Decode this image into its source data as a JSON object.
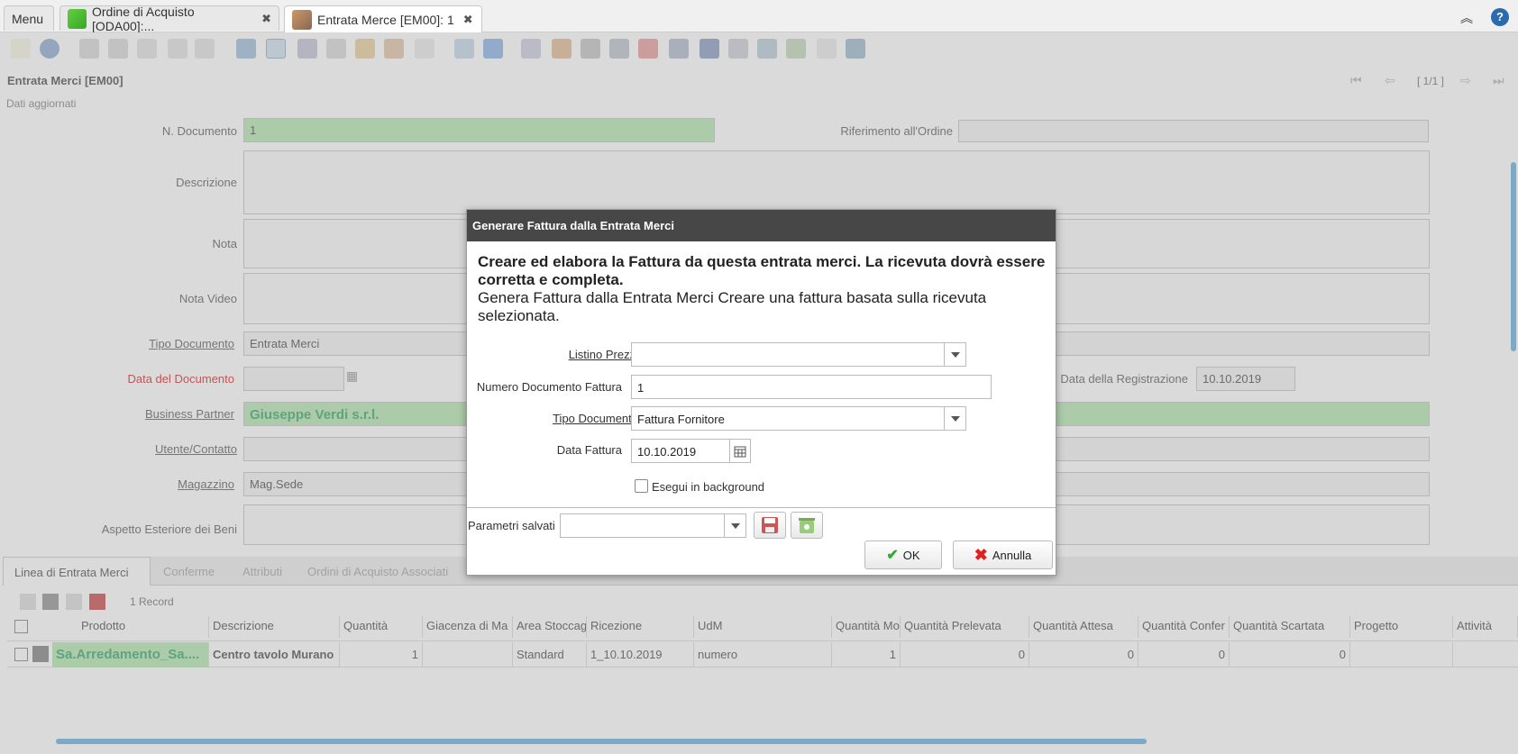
{
  "tabs": [
    {
      "label": "Menu"
    },
    {
      "label": "Ordine di Acquisto [ODA00]:..."
    },
    {
      "label": "Entrata Merce [EM00]: 1"
    }
  ],
  "window": {
    "title": "Entrata Merci [EM00]",
    "status": "Dati aggiornati",
    "record_nav": "[ 1/1 ]"
  },
  "form": {
    "n_documento_label": "N. Documento",
    "n_documento_value": "1",
    "riferimento_label": "Riferimento all'Ordine",
    "descrizione_label": "Descrizione",
    "nota_label": "Nota",
    "nota_video_label": "Nota Video",
    "tipo_documento_label": "Tipo Documento",
    "tipo_documento_value": "Entrata Merci",
    "data_documento_label": "Data del Documento",
    "data_registrazione_label": "Data della Registrazione",
    "data_registrazione_value": "10.10.2019",
    "business_partner_label": "Business Partner",
    "business_partner_value": "Giuseppe Verdi s.r.l.",
    "utente_label": "Utente/Contatto",
    "magazzino_label": "Magazzino",
    "magazzino_value": "Mag.Sede",
    "aspetto_label": "Aspetto Esteriore dei Beni"
  },
  "grid": {
    "tabs": [
      "Linea di Entrata Merci",
      "Conferme",
      "Attributi",
      "Ordini di Acquisto Associati"
    ],
    "record_count": "1 Record",
    "headers": [
      "Prodotto",
      "Descrizione",
      "Quantità",
      "Giacenza di Ma",
      "Area Stoccag",
      "Ricezione",
      "UdM",
      "Quantità Mo",
      "Quantità Prelevata",
      "Quantità Attesa",
      "Quantità Confer",
      "Quantità Scartata",
      "Progetto",
      "Attività"
    ],
    "rows": [
      {
        "prodotto": "Sa.Arredamento_Sa....",
        "descrizione": "Centro tavolo Murano",
        "quantita": "1",
        "giacenza": "",
        "area": "Standard",
        "ricezione": "1_10.10.2019",
        "udm": "numero",
        "quantita_mo": "1",
        "prelevata": "0",
        "attesa": "0",
        "confer": "0",
        "scartata": "0",
        "progetto": "",
        "attivita": ""
      }
    ]
  },
  "dialog": {
    "title": "Generare Fattura dalla Entrata Merci",
    "heading": "Creare ed elabora la Fattura da questa entrata merci. La ricevuta dovrà essere corretta e completa.",
    "description": "Genera Fattura dalla Entrata Merci Creare una fattura basata sulla ricevuta selezionata.",
    "listino_label": "Listino Prezzi",
    "listino_value": "",
    "numero_label": "Numero Documento Fattura",
    "numero_value": "1",
    "tipo_label": "Tipo Documento",
    "tipo_value": "Fattura Fornitore",
    "data_label": "Data Fattura",
    "data_value": "10.10.2019",
    "background_label": "Esegui in background",
    "parametri_label": "Parametri salvati",
    "ok_label": "OK",
    "annulla_label": "Annulla"
  },
  "colors": {
    "dialog_title_bg": "#474747",
    "green_field": "#b9e8b4",
    "scrollbar": "#6fb6e0"
  }
}
